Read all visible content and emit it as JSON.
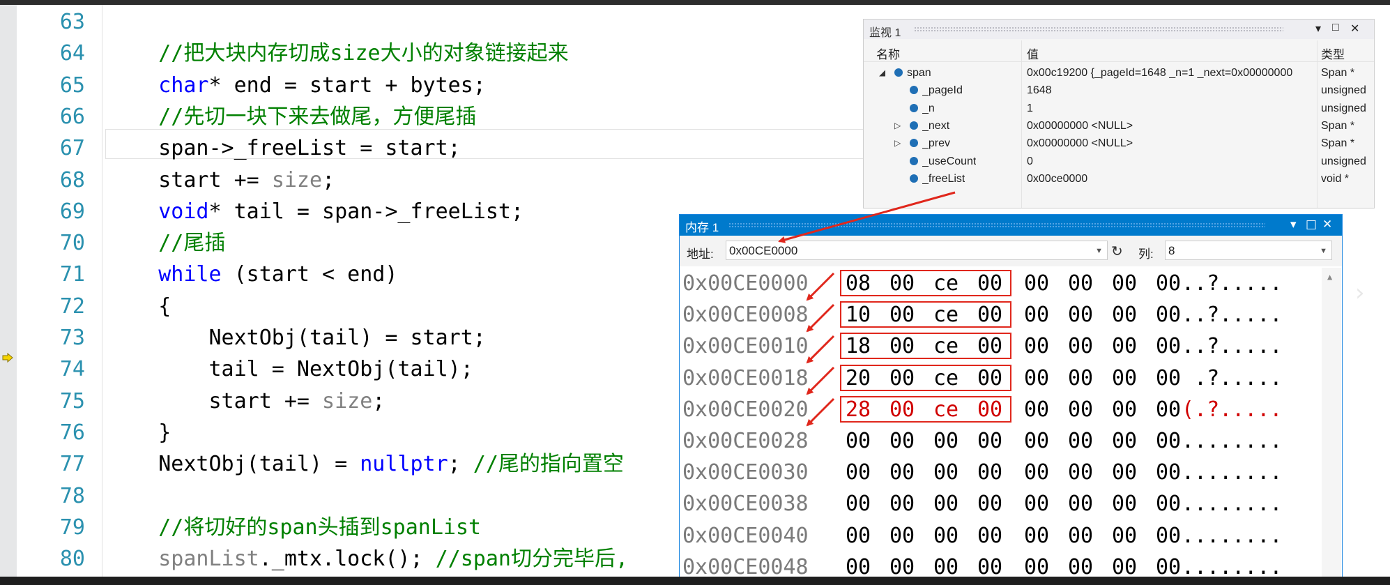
{
  "editor": {
    "lines": [
      {
        "num": "63",
        "parts": []
      },
      {
        "num": "64",
        "parts": [
          {
            "t": "    ",
            "c": ""
          },
          {
            "t": "//把大块内存切成size大小的对象链接起来",
            "c": "cm"
          }
        ]
      },
      {
        "num": "65",
        "parts": [
          {
            "t": "    ",
            "c": ""
          },
          {
            "t": "char",
            "c": "kw"
          },
          {
            "t": "* end = start + bytes;",
            "c": ""
          }
        ]
      },
      {
        "num": "66",
        "parts": [
          {
            "t": "    ",
            "c": ""
          },
          {
            "t": "//先切一块下来去做尾，方便尾插",
            "c": "cm"
          }
        ]
      },
      {
        "num": "67",
        "parts": [
          {
            "t": "    span->_freeList = start;",
            "c": ""
          }
        ]
      },
      {
        "num": "68",
        "parts": [
          {
            "t": "    start += ",
            "c": ""
          },
          {
            "t": "size",
            "c": "gr"
          },
          {
            "t": ";",
            "c": ""
          }
        ]
      },
      {
        "num": "69",
        "parts": [
          {
            "t": "    ",
            "c": ""
          },
          {
            "t": "void",
            "c": "kw"
          },
          {
            "t": "* tail = span->_freeList;",
            "c": ""
          }
        ]
      },
      {
        "num": "70",
        "parts": [
          {
            "t": "    ",
            "c": ""
          },
          {
            "t": "//尾插",
            "c": "cm"
          }
        ]
      },
      {
        "num": "71",
        "parts": [
          {
            "t": "    ",
            "c": ""
          },
          {
            "t": "while",
            "c": "kw"
          },
          {
            "t": " (start < end)",
            "c": ""
          }
        ]
      },
      {
        "num": "72",
        "parts": [
          {
            "t": "    {",
            "c": ""
          }
        ]
      },
      {
        "num": "73",
        "parts": [
          {
            "t": "        NextObj(tail) = start;",
            "c": ""
          }
        ]
      },
      {
        "num": "74",
        "parts": [
          {
            "t": "        tail = NextObj(tail);",
            "c": ""
          }
        ]
      },
      {
        "num": "75",
        "parts": [
          {
            "t": "        start += ",
            "c": ""
          },
          {
            "t": "size",
            "c": "gr"
          },
          {
            "t": ";",
            "c": ""
          }
        ]
      },
      {
        "num": "76",
        "parts": [
          {
            "t": "    }",
            "c": ""
          }
        ]
      },
      {
        "num": "77",
        "parts": [
          {
            "t": "    NextObj(tail) = ",
            "c": ""
          },
          {
            "t": "nullptr",
            "c": "kw"
          },
          {
            "t": "; ",
            "c": ""
          },
          {
            "t": "//尾的指向置空",
            "c": "cm"
          }
        ]
      },
      {
        "num": "78",
        "parts": []
      },
      {
        "num": "79",
        "parts": [
          {
            "t": "    ",
            "c": ""
          },
          {
            "t": "//将切好的span头插到spanList",
            "c": "cm"
          }
        ]
      },
      {
        "num": "80",
        "parts": [
          {
            "t": "    ",
            "c": ""
          },
          {
            "t": "spanList",
            "c": "gr"
          },
          {
            "t": "._mtx.lock(); ",
            "c": ""
          },
          {
            "t": "//span切分完毕后,",
            "c": "cm"
          }
        ]
      }
    ]
  },
  "watch": {
    "title": "监视 1",
    "col_name": "名称",
    "col_value": "值",
    "col_type": "类型",
    "rows": [
      {
        "expander": "◢",
        "name": "span",
        "value": "0x00c19200 {_pageId=1648 _n=1 _next=0x00000000",
        "type": "Span *",
        "indent": 0
      },
      {
        "expander": "",
        "name": "_pageId",
        "value": "1648",
        "type": "unsigned",
        "indent": 1
      },
      {
        "expander": "",
        "name": "_n",
        "value": "1",
        "type": "unsigned",
        "indent": 1
      },
      {
        "expander": "▷",
        "name": "_next",
        "value": "0x00000000 <NULL>",
        "type": "Span *",
        "indent": 1
      },
      {
        "expander": "▷",
        "name": "_prev",
        "value": "0x00000000 <NULL>",
        "type": "Span *",
        "indent": 1
      },
      {
        "expander": "",
        "name": "_useCount",
        "value": "0",
        "type": "unsigned",
        "indent": 1
      },
      {
        "expander": "",
        "name": "_freeList",
        "value": "0x00ce0000",
        "type": "void *",
        "indent": 1
      }
    ]
  },
  "memory": {
    "title": "内存 1",
    "address_label": "地址:",
    "address_value": "0x00CE0000",
    "columns_label": "列:",
    "columns_value": "8",
    "rows": [
      {
        "addr": "0x00CE0000",
        "bytes": [
          "08",
          "00",
          "ce",
          "00",
          "00",
          "00",
          "00",
          "00"
        ],
        "ascii": "..?.....",
        "hl": true,
        "changed": false
      },
      {
        "addr": "0x00CE0008",
        "bytes": [
          "10",
          "00",
          "ce",
          "00",
          "00",
          "00",
          "00",
          "00"
        ],
        "ascii": "..?.....",
        "hl": true,
        "changed": false
      },
      {
        "addr": "0x00CE0010",
        "bytes": [
          "18",
          "00",
          "ce",
          "00",
          "00",
          "00",
          "00",
          "00"
        ],
        "ascii": "..?.....",
        "hl": true,
        "changed": false
      },
      {
        "addr": "0x00CE0018",
        "bytes": [
          "20",
          "00",
          "ce",
          "00",
          "00",
          "00",
          "00",
          "00"
        ],
        "ascii": " .?.....",
        "hl": true,
        "changed": false
      },
      {
        "addr": "0x00CE0020",
        "bytes": [
          "28",
          "00",
          "ce",
          "00",
          "00",
          "00",
          "00",
          "00"
        ],
        "ascii": "(.?.....",
        "hl": true,
        "changed": true
      },
      {
        "addr": "0x00CE0028",
        "bytes": [
          "00",
          "00",
          "00",
          "00",
          "00",
          "00",
          "00",
          "00"
        ],
        "ascii": "........",
        "hl": false,
        "changed": false
      },
      {
        "addr": "0x00CE0030",
        "bytes": [
          "00",
          "00",
          "00",
          "00",
          "00",
          "00",
          "00",
          "00"
        ],
        "ascii": "........",
        "hl": false,
        "changed": false
      },
      {
        "addr": "0x00CE0038",
        "bytes": [
          "00",
          "00",
          "00",
          "00",
          "00",
          "00",
          "00",
          "00"
        ],
        "ascii": "........",
        "hl": false,
        "changed": false
      },
      {
        "addr": "0x00CE0040",
        "bytes": [
          "00",
          "00",
          "00",
          "00",
          "00",
          "00",
          "00",
          "00"
        ],
        "ascii": "........",
        "hl": false,
        "changed": false
      },
      {
        "addr": "0x00CE0048",
        "bytes": [
          "00",
          "00",
          "00",
          "00",
          "00",
          "00",
          "00",
          "00"
        ],
        "ascii": "........",
        "hl": false,
        "changed": false
      }
    ]
  },
  "colors": {
    "accent": "#007acc",
    "highlight_box": "#e0271c",
    "changed_value": "#d00000",
    "line_number": "#2b91af",
    "keyword": "#0000ff",
    "comment": "#008000"
  },
  "icons": {
    "breakpoint": "current-statement-arrow-icon",
    "refresh": "refresh-icon",
    "watch_pin": "pin-icon",
    "close": "close-icon",
    "maximize": "maximize-icon",
    "dropdown": "chevron-down-icon"
  }
}
